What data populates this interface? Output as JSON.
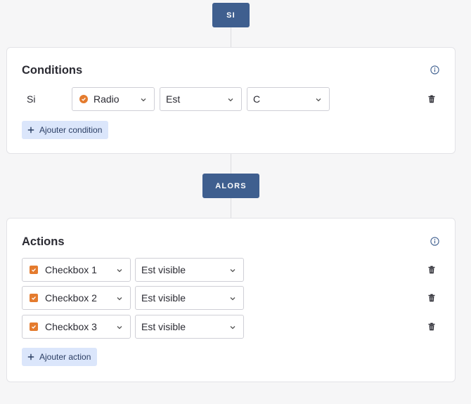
{
  "flow": {
    "if_label": "SI",
    "then_label": "ALORS"
  },
  "conditions": {
    "title": "Conditions",
    "row_prefix": "Si",
    "field": {
      "label": "Radio",
      "icon": "radio-icon"
    },
    "operator": "Est",
    "value": "C",
    "add_label": "Ajouter condition"
  },
  "actions": {
    "title": "Actions",
    "rows": [
      {
        "target": "Checkbox 1",
        "action": "Est visible"
      },
      {
        "target": "Checkbox 2",
        "action": "Est visible"
      },
      {
        "target": "Checkbox 3",
        "action": "Est visible"
      }
    ],
    "add_label": "Ajouter action"
  },
  "colors": {
    "pill": "#3f5f8f",
    "field_icon": "#e47b2e",
    "add_button_bg": "#dbe6fb"
  }
}
